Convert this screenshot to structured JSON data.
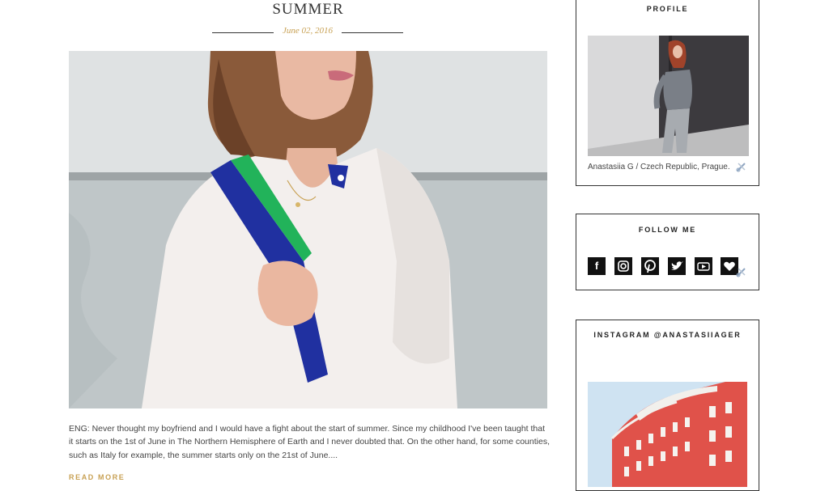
{
  "post": {
    "title": "SUMMER",
    "date": "June 02, 2016",
    "excerpt": "ENG: Never thought my boyfriend and I would have a fight about the start of summer. Since my childhood I've been taught that it starts on the 1st of June in The Northern Hemisphere of Earth and I never doubted that. On the other hand, for some counties, such as Italy for example, the summer starts only on the 21st of June....",
    "read_more": "READ MORE"
  },
  "sidebar": {
    "profile": {
      "title": "PROFILE",
      "caption": "Anastasiia G / Czech Republic, Prague."
    },
    "follow": {
      "title": "FOLLOW ME",
      "icons": [
        "facebook-icon",
        "instagram-icon",
        "pinterest-icon",
        "twitter-icon",
        "youtube-icon",
        "bloglovin-heart-icon"
      ]
    },
    "instagram": {
      "title": "INSTAGRAM @ANASTASIIAGER"
    }
  },
  "colors": {
    "accent_gold": "#c8a154",
    "text": "#444444",
    "border": "#333333"
  }
}
